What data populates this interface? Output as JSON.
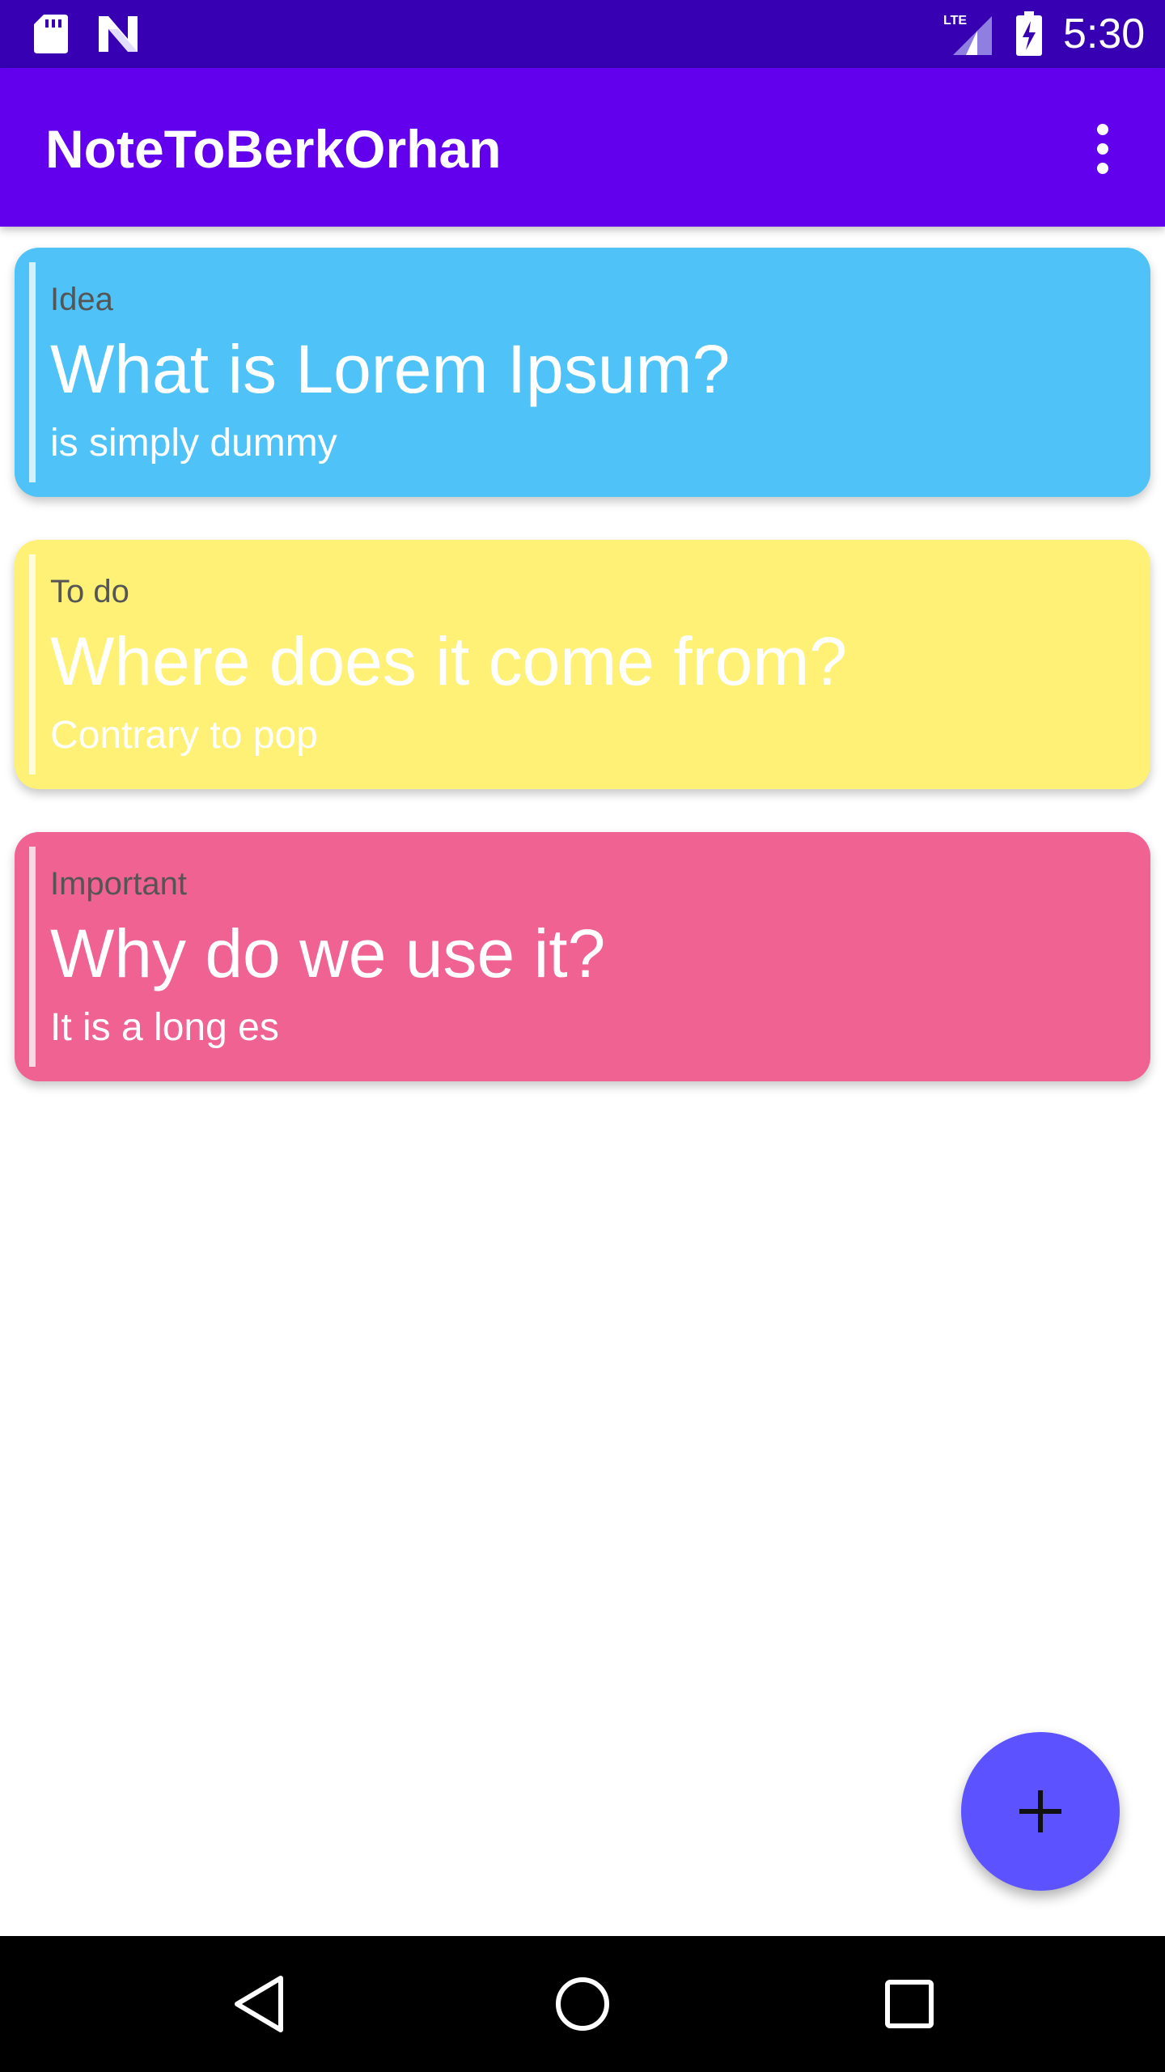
{
  "status_bar": {
    "time": "5:30",
    "icons": [
      "sd-card-icon",
      "n-logo-icon",
      "lte-signal-icon",
      "battery-charging-icon"
    ]
  },
  "app_bar": {
    "title": "NoteToBerkOrhan",
    "menu_icon": "more-vert-icon"
  },
  "notes": [
    {
      "category": "Idea",
      "title": "What is Lorem Ipsum?",
      "preview": "is simply dummy",
      "color": "#4fc3f7"
    },
    {
      "category": "To do",
      "title": "Where does it come from?",
      "preview": "Contrary to pop",
      "color": "#fff176"
    },
    {
      "category": "Important",
      "title": "Why do we use it?",
      "preview": "It is a long es",
      "color": "#f06292"
    }
  ],
  "fab": {
    "icon": "plus-icon",
    "color": "#5c52ff"
  },
  "nav_bar": {
    "icons": [
      "back-icon",
      "home-icon",
      "recents-icon"
    ]
  },
  "colors": {
    "status_bar": "#3700b3",
    "app_bar": "#6200ee"
  }
}
